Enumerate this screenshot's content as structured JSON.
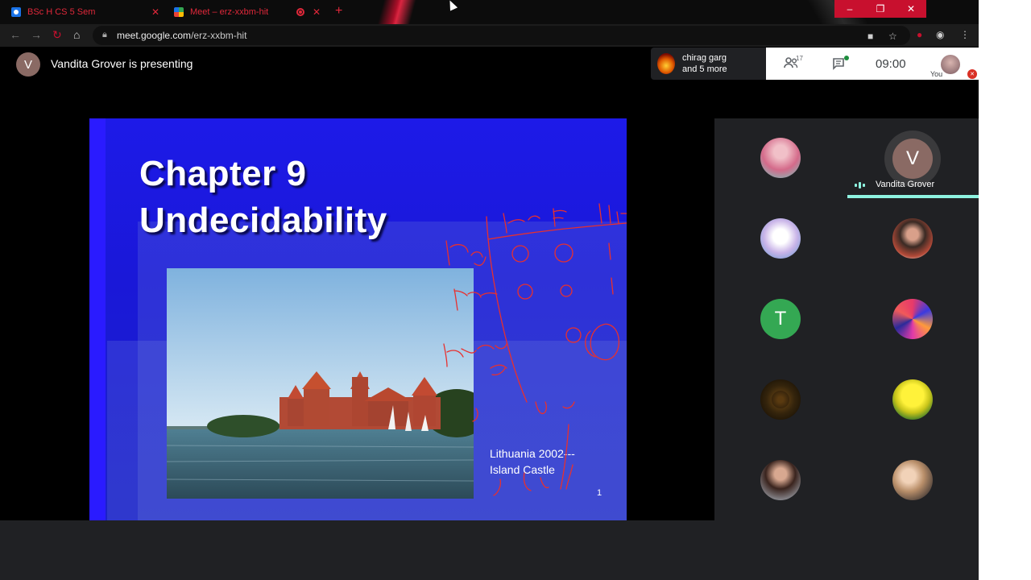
{
  "browser": {
    "tabs": [
      {
        "title": "BSc H CS 5 Sem",
        "favicon": "google-classroom-icon"
      },
      {
        "title": "Meet – erz-xxbm-hit",
        "favicon": "google-meet-icon",
        "recording": true
      }
    ],
    "url_host": "meet.google.com",
    "url_path": "/erz-xxbm-hit",
    "accent": "#c8102e"
  },
  "meet": {
    "presenter_initial": "V",
    "presenting_text": "Vandita Grover is presenting",
    "recent_joiner_line1": "chirag garg",
    "recent_joiner_line2": "and 5 more",
    "participant_count": "17",
    "clock": "09:00",
    "self_label": "You"
  },
  "slide": {
    "title_line1": "Chapter 9",
    "title_line2": "Undecidability",
    "caption_line1": "Lithuania 2002---",
    "caption_line2": "Island Castle",
    "page_number": "1",
    "background": "#1d1ae8"
  },
  "participants": {
    "speaker_name": "Vandita Grover",
    "speaker_initial": "V",
    "t_initial": "T",
    "speaker_color": "#8ef3e0"
  }
}
